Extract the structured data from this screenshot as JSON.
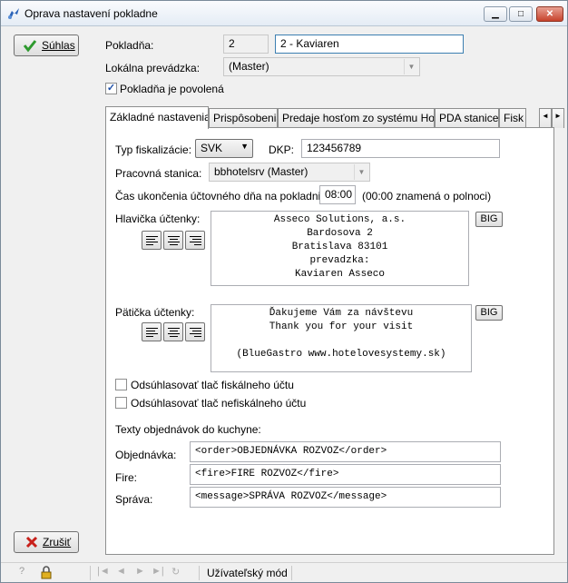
{
  "window": {
    "title": "Oprava nastavení pokladne"
  },
  "buttons": {
    "ok": "Súhlas",
    "cancel": "Zrušiť",
    "big": "BIG"
  },
  "top": {
    "pokladna_label": "Pokladňa:",
    "pokladna_num": "2",
    "pokladna_name": "2 - Kaviaren",
    "prevadzka_label": "Lokálna prevádzka:",
    "prevadzka_value": "(Master)",
    "povolena_label": "Pokladňa je povolená",
    "povolena_checked": true
  },
  "tabs": [
    "Základné nastavenia",
    "Prispôsobenia",
    "Predaje hosťom zo systému Horec",
    "PDA stanice",
    "Fisk"
  ],
  "basic": {
    "fisk_label": "Typ fiskalizácie:",
    "fisk_value": "SVK",
    "dkp_label": "DKP:",
    "dkp_value": "123456789",
    "stanica_label": "Pracovná stanica:",
    "stanica_value": "bbhotelsrv (Master)",
    "cas_label": "Čas ukončenia účtovného dňa na pokladni:",
    "cas_value": "08:00",
    "cas_note": "(00:00 znamená o polnoci)",
    "hlavicka_label": "Hlavička účtenky:",
    "hlavicka_lines": [
      "Asseco Solutions, a.s.",
      "Bardosova 2",
      "Bratislava 83101",
      "prevadzka:",
      "Kaviaren Asseco"
    ],
    "paticka_label": "Pätička účtenky:",
    "paticka_lines": [
      "Ďakujeme Vám za návštevu",
      "Thank you for your visit",
      "",
      "(BlueGastro www.hotelovesystemy.sk)"
    ],
    "fiskal_check": "Odsúhlasovať tlač fiskálneho účtu",
    "nefiskal_check": "Odsúhlasovať tlač nefiskálneho účtu",
    "kuchyna_label": "Texty objednávok do kuchyne:",
    "objednavka_label": "Objednávka:",
    "objednavka_value": "<order>OBJEDNÁVKA ROZVOZ</order>",
    "fire_label": "Fire:",
    "fire_value": "<fire>FIRE ROZVOZ</fire>",
    "sprava_label": "Správa:",
    "sprava_value": "<message>SPRÁVA ROZVOZ</message>"
  },
  "status": {
    "mode": "Užívateľský mód"
  }
}
